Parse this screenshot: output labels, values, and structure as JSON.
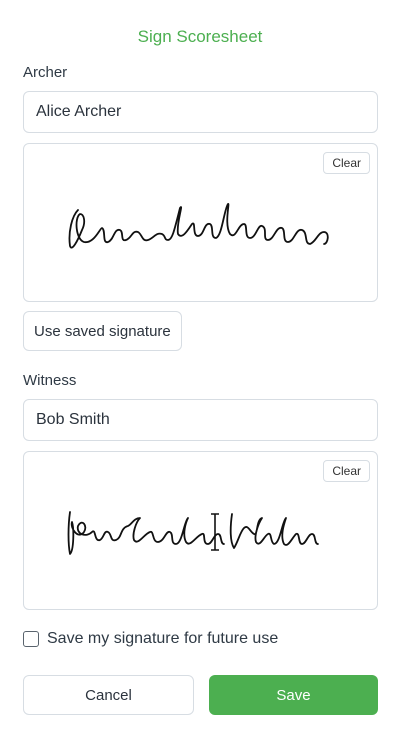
{
  "dialog": {
    "title": "Sign Scoresheet",
    "accent_color": "#4caf50"
  },
  "archer": {
    "label": "Archer",
    "name_value": "Alice Archer",
    "clear_label": "Clear",
    "use_saved_label": "Use saved signature"
  },
  "witness": {
    "label": "Witness",
    "name_value": "Bob Smith",
    "clear_label": "Clear"
  },
  "save_signature": {
    "label": "Save my signature for future use",
    "checked": false
  },
  "actions": {
    "cancel_label": "Cancel",
    "save_label": "Save"
  }
}
